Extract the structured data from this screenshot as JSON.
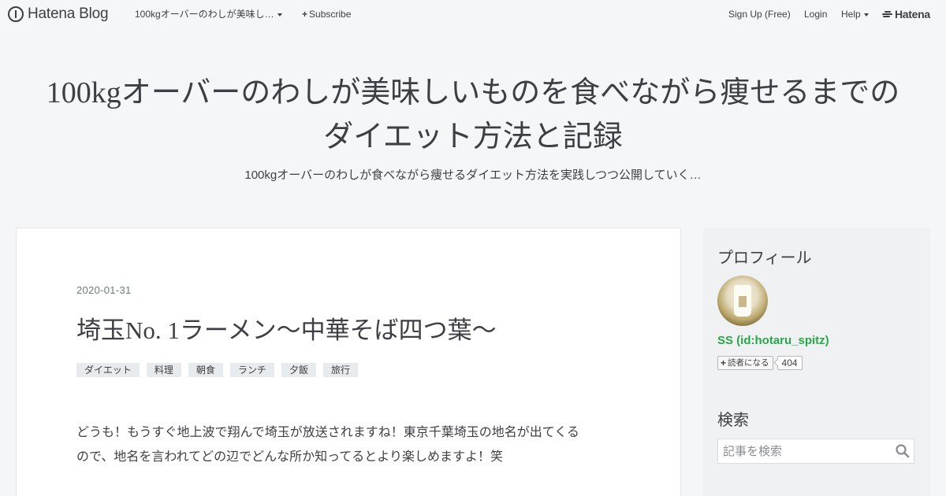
{
  "navbar": {
    "brand": "Hatena Blog",
    "blog_menu": "100kgオーバーのわしが美味し…",
    "subscribe": "Subscribe",
    "signup": "Sign Up (Free)",
    "login": "Login",
    "help": "Help",
    "hatena": "Hatena",
    "icons": [
      "hatena-blog-logo-icon",
      "plus-icon",
      "chevron-down-icon",
      "hatena-logo-icon"
    ]
  },
  "blog": {
    "title_line1": "100kgオーバーのわしが美味しいものを食べながら痩せるまでの",
    "title_line2": "ダイエット方法と記録",
    "description": "100kgオーバーのわしが食べながら痩せるダイエット方法を実践しつつ公開していく…"
  },
  "entry": {
    "date": "2020-01-31",
    "title": "埼玉No. 1ラーメン〜中華そば四つ葉〜",
    "categories": [
      "ダイエット",
      "料理",
      "朝食",
      "ランチ",
      "夕飯",
      "旅行"
    ],
    "body_line1": "どうも！もうすぐ地上波で翔んで埼玉が放送されますね！東京千葉埼玉の地名が出てくる",
    "body_line2": "ので、地名を言われてどの辺でどんな所か知ってるとより楽しめますよ！笑"
  },
  "sidebar": {
    "profile_title": "プロフィール",
    "profile_name": "SS (id:hotaru_spitz)",
    "subscribe_label": "読者になる",
    "subscriber_count": "404",
    "search_title": "検索",
    "search_placeholder": "記事を検索"
  },
  "colors": {
    "page_background": "#f5f6f7",
    "text": "#3d3f44",
    "date": "#6a7e73",
    "profile_link": "#27a84a",
    "category_background": "#e8ebed"
  }
}
